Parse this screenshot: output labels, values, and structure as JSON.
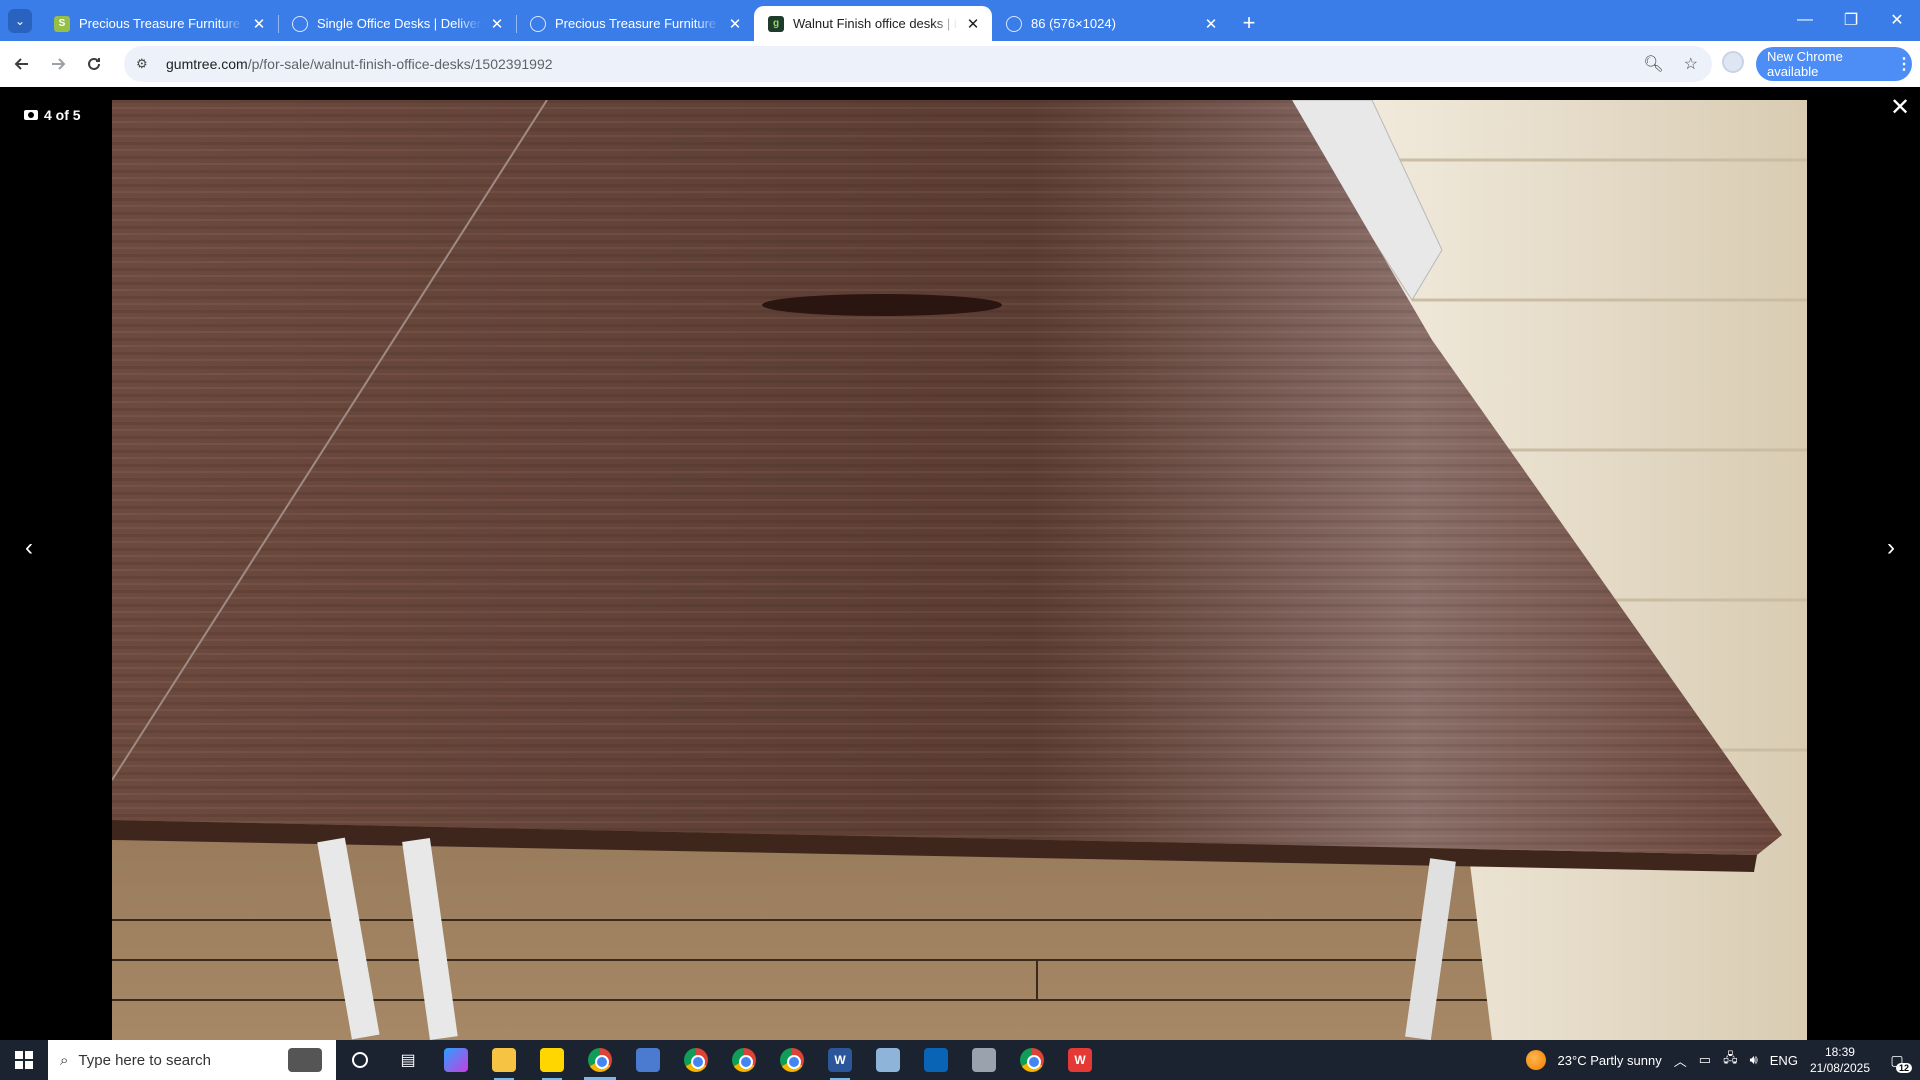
{
  "browser": {
    "tabs": [
      {
        "title": "Precious Treasure Furniture · Pr",
        "favicon": "shopify-icon",
        "active": false
      },
      {
        "title": "Single Office Desks | Delivery av",
        "favicon": "globe-icon",
        "active": false
      },
      {
        "title": "Precious Treasure Furniture | Aff",
        "favicon": "globe-icon",
        "active": false
      },
      {
        "title": "Walnut Finish office desks | in C",
        "favicon": "gumtree-icon",
        "active": true
      },
      {
        "title": "86 (576×1024)",
        "favicon": "globe-icon",
        "active": false
      }
    ],
    "url_host": "gumtree.com",
    "url_path": "/p/for-sale/walnut-finish-office-desks/1502391992",
    "update_label": "New Chrome available"
  },
  "gallery": {
    "counter": "4 of 5",
    "image_subject": "walnut-finish office desk top",
    "colors": {
      "desk": "#6b4436",
      "floor": "#a08060",
      "wall": "#e8dcc6"
    }
  },
  "taskbar": {
    "search_placeholder": "Type here to search",
    "weather": "23°C  Partly sunny",
    "language": "ENG",
    "time": "18:39",
    "date": "21/08/2025",
    "notifications": "12"
  }
}
